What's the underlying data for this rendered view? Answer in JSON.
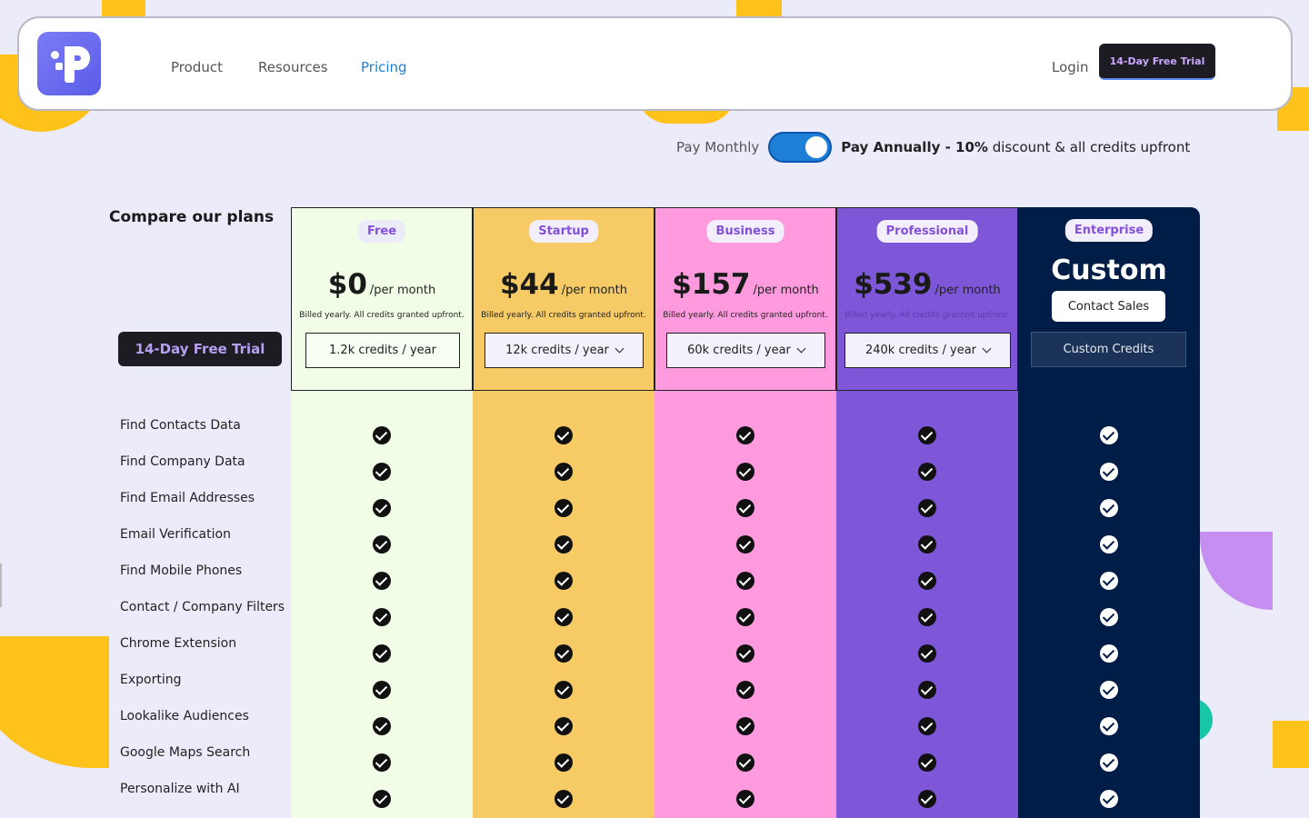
{
  "nav": {
    "items": [
      "Product",
      "Resources",
      "Pricing"
    ],
    "active": "Pricing",
    "login": "Login",
    "trial_button": "14-Day Free Trial"
  },
  "billing": {
    "monthly_label": "Pay Monthly",
    "annual_bold": "Pay Annually - 10%",
    "annual_rest": "discount & all credits upfront",
    "annual_selected": true
  },
  "compare": {
    "title": "Compare our plans",
    "trial_button": "14-Day Free Trial"
  },
  "features": [
    "Find Contacts Data",
    "Find Company Data",
    "Find Email Addresses",
    "Email Verification",
    "Find Mobile Phones",
    "Contact / Company Filters",
    "Chrome Extension",
    "Exporting",
    "Lookalike Audiences",
    "Google Maps Search",
    "Personalize with AI"
  ],
  "plans": [
    {
      "name": "Free",
      "price": "$0",
      "per": "/per month",
      "billed": "Billed yearly. All credits granted upfront.",
      "credits": "1.2k credits / year",
      "color": "#f2fde8"
    },
    {
      "name": "Startup",
      "price": "$44",
      "per": "/per month",
      "billed": "Billed yearly. All credits granted upfront.",
      "credits": "12k credits / year",
      "color": "#f6cb66"
    },
    {
      "name": "Business",
      "price": "$157",
      "per": "/per month",
      "billed": "Billed yearly. All credits granted upfront.",
      "credits": "60k credits / year",
      "color": "#ff9ade"
    },
    {
      "name": "Professional",
      "price": "$539",
      "per": "/per month",
      "billed": "Billed yearly. All credits granted upfront.",
      "credits": "240k credits / year",
      "color": "#7d57d8"
    },
    {
      "name": "Enterprise",
      "price": "Custom",
      "contact": "Contact Sales",
      "credits": "Custom Credits",
      "color": "#001d48"
    }
  ],
  "icons": {
    "check": "check-circle-icon",
    "dropdown": "chevron-down-icon"
  }
}
